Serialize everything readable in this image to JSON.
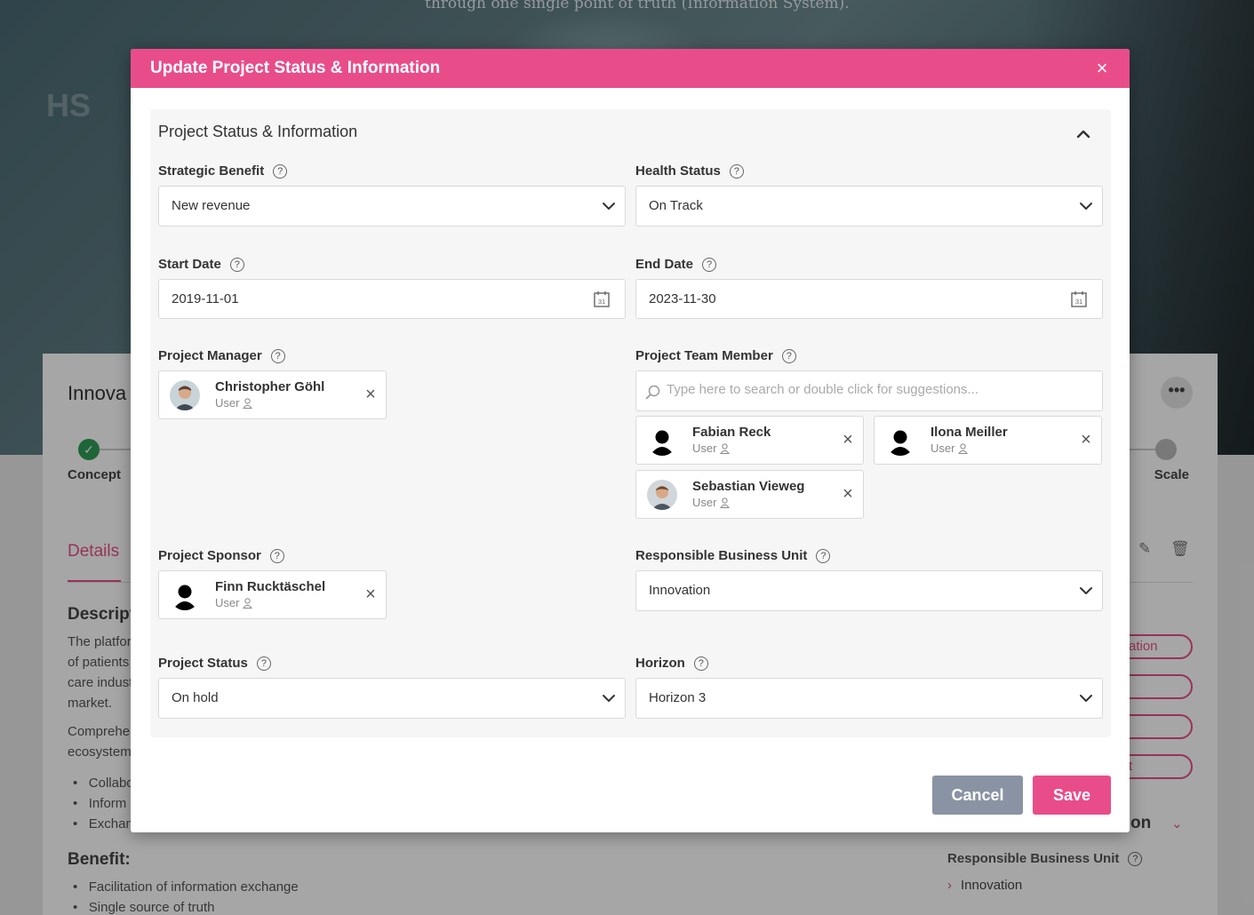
{
  "background": {
    "hero_tagline": "through one single point of truth (Information System).",
    "hero_watermark": "HS",
    "page_title": "Innova",
    "more_icon": "ellipsis-icon",
    "stages": {
      "first": "Concept",
      "last": "Scale"
    },
    "details_tab": "Details",
    "description_heading": "Descript",
    "description_text": [
      "The platfor",
      "of patients",
      "care indust",
      "market."
    ],
    "comprehensive_text": [
      "Comprehe",
      "ecosystem"
    ],
    "bullets": [
      "Collabo",
      "Inform",
      "Exchan"
    ],
    "benefit_heading": "Benefit:",
    "benefit_bullets": [
      "Facilitation of information exchange",
      "Single source of truth"
    ],
    "side_pills": [
      "ation",
      "",
      "",
      "t"
    ],
    "side_section_heading": "on",
    "side_field_label": "Responsible Business Unit",
    "side_field_value": "Innovation"
  },
  "modal": {
    "title": "Update Project Status & Information",
    "section_title": "Project Status & Information",
    "fields": {
      "strategic_benefit": {
        "label": "Strategic Benefit",
        "value": "New revenue"
      },
      "health_status": {
        "label": "Health Status",
        "value": "On Track"
      },
      "start_date": {
        "label": "Start Date",
        "value": "2019-11-01"
      },
      "end_date": {
        "label": "End Date",
        "value": "2023-11-30"
      },
      "project_manager": {
        "label": "Project Manager"
      },
      "project_team_member": {
        "label": "Project Team Member",
        "placeholder": "Type here to search or double click for suggestions..."
      },
      "project_sponsor": {
        "label": "Project Sponsor"
      },
      "responsible_business_unit": {
        "label": "Responsible Business Unit",
        "value": "Innovation"
      },
      "project_status": {
        "label": "Project Status",
        "value": "On hold"
      },
      "horizon": {
        "label": "Horizon",
        "value": "Horizon 3"
      }
    },
    "people": {
      "manager": {
        "name": "Christopher Göhl",
        "role": "User"
      },
      "team": [
        {
          "name": "Fabian Reck",
          "role": "User"
        },
        {
          "name": "Ilona Meiller",
          "role": "User"
        },
        {
          "name": "Sebastian Vieweg",
          "role": "User"
        }
      ],
      "sponsor": {
        "name": "Finn Rucktäschel",
        "role": "User"
      }
    },
    "buttons": {
      "cancel": "Cancel",
      "save": "Save"
    },
    "help_glyph": "?",
    "close_glyph": "×",
    "remove_glyph": "×"
  },
  "colors": {
    "accent": "#e84d8a",
    "cancel": "#8a93a3",
    "success": "#2e9c55"
  }
}
